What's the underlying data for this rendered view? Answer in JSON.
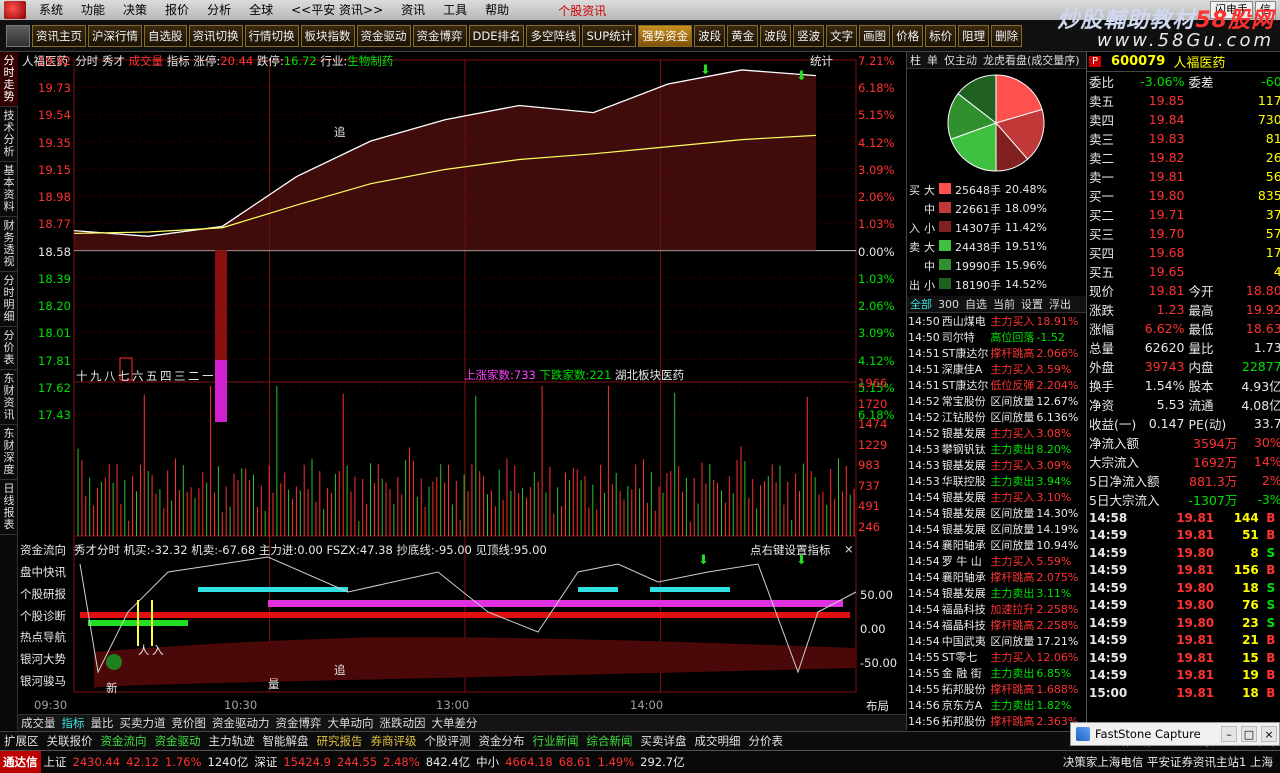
{
  "menu": {
    "items": [
      "系统",
      "功能",
      "决策",
      "报价",
      "分析",
      "全球",
      "<<平安 资讯>>",
      "资讯",
      "工具",
      "帮助"
    ],
    "center_text": "个股资讯",
    "right_buttons": [
      "闪电手",
      "信"
    ]
  },
  "toolbar": {
    "buttons": [
      "资讯主页",
      "沪深行情",
      "自选股",
      "资讯切换",
      "行情切换",
      "板块指数",
      "资金驱动",
      "资金博弈",
      "DDE排名",
      "多空阵线",
      "SUP统计",
      "强势资金",
      "波段",
      "黄金",
      "波段",
      "竖波",
      "文字",
      "画图",
      "价格",
      "标价",
      "阻理",
      "删除"
    ],
    "active_index": 11
  },
  "watermark": {
    "line1_a": "炒股輔助教材",
    "line1_b": "58股网",
    "line2": "www.58Gu.com"
  },
  "left_tabs": [
    "分时走势",
    "技术分析",
    "基本资料",
    "财务透视",
    "分时明细",
    "分价表",
    "东财资讯",
    "东财深度",
    "日线报表"
  ],
  "chart": {
    "header": {
      "name": "人福医药",
      "mode": "分时",
      "tags": [
        "秀才",
        "成交量",
        "指标"
      ],
      "limit_up_label": "涨停:",
      "limit_up": "20.44",
      "limit_down_label": "跌停:",
      "limit_down": "16.72",
      "industry_label": "行业:",
      "industry": "生物制药",
      "stats": "统计"
    },
    "price_ticks": [
      "19.92",
      "19.73",
      "19.54",
      "19.35",
      "19.15",
      "18.98",
      "18.77",
      "18.58",
      "18.39",
      "18.20",
      "18.01",
      "17.81",
      "17.62",
      "17.43"
    ],
    "pct_ticks": [
      "7.21%",
      "6.18%",
      "5.15%",
      "4.12%",
      "3.09%",
      "2.06%",
      "1.03%",
      "0.00%",
      "1.03%",
      "2.06%",
      "3.09%",
      "4.12%",
      "5.15%",
      "6.18%"
    ],
    "vol_ticks": [
      "1966",
      "1720",
      "1474",
      "1229",
      "983",
      "737",
      "491",
      "246"
    ],
    "pos_labels": [
      "十",
      "九",
      "八",
      "七",
      "六",
      "五",
      "四",
      "三",
      "二",
      "一"
    ],
    "up_count_label": "上涨家数:",
    "up_count": "733",
    "down_count_label": "下跌家数:",
    "down_count": "221",
    "sector": "湖北板块医药",
    "chase_label": "追",
    "panel2_title": "资金流向",
    "panel2_line": "秀才分时  机买:-32.32  机卖:-67.68  主力进:0.00  FSZX:47.38  抄底线:-95.00  见顶线:95.00",
    "panel2_right": "点右键设置指标",
    "panel2_ticks": [
      "50.00",
      "0.00",
      "-50.00"
    ],
    "panel2_marks": [
      "新",
      "量",
      "追",
      "入",
      "人"
    ],
    "side_menu": [
      "盘中快讯",
      "个股研报",
      "个股诊断",
      "热点导航",
      "银河大势",
      "银河骏马"
    ],
    "time_labels": [
      "09:30",
      "10:30",
      "13:00",
      "14:00"
    ],
    "layout_btn": "布局"
  },
  "chart_data": {
    "type": "line",
    "title": "人福医药 分时",
    "x": [
      "09:30",
      "10:30",
      "13:00",
      "14:00",
      "15:00"
    ],
    "y_range": [
      17.43,
      19.92
    ],
    "prev_close": 18.58,
    "price": [
      18.72,
      18.68,
      18.75,
      19.1,
      19.35,
      19.5,
      19.6,
      19.55,
      19.75,
      19.85,
      19.81
    ],
    "avg": [
      18.7,
      18.71,
      18.74,
      18.9,
      19.05,
      19.15,
      19.22,
      19.26,
      19.31,
      19.36,
      19.39
    ]
  },
  "flow": {
    "tabs": [
      "柱",
      "单",
      "仅主动",
      "龙虎看盘(成交量序)"
    ],
    "rows": [
      {
        "side": "买",
        "size": "大",
        "val": "25648手",
        "pct": "20.48%",
        "color": "#ff5050"
      },
      {
        "side": "",
        "size": "中",
        "val": "22661手",
        "pct": "18.09%",
        "color": "#c03838"
      },
      {
        "side": "入",
        "size": "小",
        "val": "14307手",
        "pct": "11.42%",
        "color": "#802020"
      },
      {
        "side": "卖",
        "size": "大",
        "val": "24438手",
        "pct": "19.51%",
        "color": "#40c040"
      },
      {
        "side": "",
        "size": "中",
        "val": "19990手",
        "pct": "15.96%",
        "color": "#309030"
      },
      {
        "side": "出",
        "size": "小",
        "val": "18190手",
        "pct": "14.52%",
        "color": "#206020"
      }
    ],
    "pie": [
      20.48,
      18.09,
      11.42,
      19.51,
      15.96,
      14.52
    ]
  },
  "news_tabs": [
    "全部",
    "300",
    "自选",
    "当前",
    "设置",
    "浮出"
  ],
  "news": [
    [
      "14:50",
      "西山煤电",
      "主力买入",
      "18.91%",
      "r"
    ],
    [
      "14:50",
      "司尔特",
      "高位回落",
      "-1.52",
      "g"
    ],
    [
      "14:51",
      "ST康达尔",
      "撑杆跳高",
      "2.066%",
      "r"
    ],
    [
      "14:51",
      "深康佳A",
      "主力买入",
      "3.59%",
      "r"
    ],
    [
      "14:51",
      "ST康达尔",
      "低位反弹",
      "2.204%",
      "r"
    ],
    [
      "14:52",
      "常宝股份",
      "区间放量",
      "12.67%",
      "w"
    ],
    [
      "14:52",
      "江钻股份",
      "区间放量",
      "6.136%",
      "w"
    ],
    [
      "14:52",
      "银基发展",
      "主力买入",
      "3.08%",
      "r"
    ],
    [
      "14:53",
      "攀钢钒钛",
      "主力卖出",
      "8.20%",
      "g"
    ],
    [
      "14:53",
      "银基发展",
      "主力买入",
      "3.09%",
      "r"
    ],
    [
      "14:53",
      "华联控股",
      "主力卖出",
      "3.94%",
      "g"
    ],
    [
      "14:54",
      "银基发展",
      "主力买入",
      "3.10%",
      "r"
    ],
    [
      "14:54",
      "银基发展",
      "区间放量",
      "14.30%",
      "w"
    ],
    [
      "14:54",
      "银基发展",
      "区间放量",
      "14.19%",
      "w"
    ],
    [
      "14:54",
      "襄阳轴承",
      "区间放量",
      "10.94%",
      "w"
    ],
    [
      "14:54",
      "罗 牛 山",
      "主力买入",
      "5.59%",
      "r"
    ],
    [
      "14:54",
      "襄阳轴承",
      "撑杆跳高",
      "2.075%",
      "r"
    ],
    [
      "14:54",
      "银基发展",
      "主力卖出",
      "3.11%",
      "g"
    ],
    [
      "14:54",
      "福晶科技",
      "加速拉升",
      "2.258%",
      "r"
    ],
    [
      "14:54",
      "福晶科技",
      "撑杆跳高",
      "2.258%",
      "r"
    ],
    [
      "14:54",
      "中国武夷",
      "区间放量",
      "17.21%",
      "w"
    ],
    [
      "14:55",
      "ST零七",
      "主力买入",
      "12.06%",
      "r"
    ],
    [
      "14:55",
      "金 融 街",
      "主力卖出",
      "6.85%",
      "g"
    ],
    [
      "14:55",
      "拓邦股份",
      "撑杆跳高",
      "1.688%",
      "r"
    ],
    [
      "14:56",
      "京东方A",
      "主力卖出",
      "1.82%",
      "g"
    ],
    [
      "14:56",
      "拓邦股份",
      "撑杆跳高",
      "2.363%",
      "r"
    ],
    [
      "14:56",
      "南 京 港",
      "加速拉升",
      "4.463%",
      "r"
    ],
    [
      "14:56",
      "福晶科技",
      "区间放量",
      "10.94%",
      "w"
    ],
    [
      "14:56",
      "拓邦股份",
      "单笔冲击",
      "-2",
      "g"
    ]
  ],
  "quote": {
    "code": "600079",
    "name": "人福医药",
    "wei_bi_label": "委比",
    "wei_bi": "-3.06%",
    "wei_cha_label": "委差",
    "wei_cha": "-60",
    "asks": [
      {
        "l": "卖五",
        "p": "19.85",
        "v": "117"
      },
      {
        "l": "卖四",
        "p": "19.84",
        "v": "730"
      },
      {
        "l": "卖三",
        "p": "19.83",
        "v": "81"
      },
      {
        "l": "卖二",
        "p": "19.82",
        "v": "26"
      },
      {
        "l": "卖一",
        "p": "19.81",
        "v": "56"
      }
    ],
    "bids": [
      {
        "l": "买一",
        "p": "19.80",
        "v": "835"
      },
      {
        "l": "买二",
        "p": "19.71",
        "v": "37"
      },
      {
        "l": "买三",
        "p": "19.70",
        "v": "57"
      },
      {
        "l": "买四",
        "p": "19.68",
        "v": "17"
      },
      {
        "l": "买五",
        "p": "19.65",
        "v": "4"
      }
    ],
    "stats": [
      [
        "现价",
        "19.81",
        "今开",
        "18.80"
      ],
      [
        "涨跌",
        "1.23",
        "最高",
        "19.92"
      ],
      [
        "涨幅",
        "6.62%",
        "最低",
        "18.63"
      ],
      [
        "总量",
        "62620",
        "量比",
        "1.73"
      ],
      [
        "外盘",
        "39743",
        "内盘",
        "22877"
      ],
      [
        "换手",
        "1.54%",
        "股本",
        "4.93亿"
      ],
      [
        "净资",
        "5.53",
        "流通",
        "4.08亿"
      ],
      [
        "收益(一)",
        "0.147",
        "PE(动)",
        "33.7"
      ]
    ],
    "flows": [
      [
        "净流入额",
        "3594万",
        "30%"
      ],
      [
        "大宗流入",
        "1692万",
        "14%"
      ],
      [
        "5日净流入额",
        "881.3万",
        "2%"
      ],
      [
        "5日大宗流入",
        "-1307万",
        "-3%"
      ]
    ],
    "deals": [
      [
        "14:58",
        "19.81",
        "144",
        "B"
      ],
      [
        "14:59",
        "19.81",
        "51",
        "B"
      ],
      [
        "14:59",
        "19.80",
        "8",
        "S"
      ],
      [
        "14:59",
        "19.81",
        "156",
        "B"
      ],
      [
        "14:59",
        "19.80",
        "18",
        "S"
      ],
      [
        "14:59",
        "19.80",
        "76",
        "S"
      ],
      [
        "14:59",
        "19.80",
        "23",
        "S"
      ],
      [
        "14:59",
        "19.81",
        "21",
        "B"
      ],
      [
        "14:59",
        "19.81",
        "15",
        "B"
      ],
      [
        "14:59",
        "19.81",
        "19",
        "B"
      ],
      [
        "15:00",
        "19.81",
        "18",
        "B"
      ]
    ]
  },
  "bottom_tabs1": [
    "成交量",
    "指标",
    "量比",
    "买卖力道",
    "竞价图",
    "资金驱动力",
    "资金博弈",
    "大单动向",
    "涨跌动因",
    "大单差分"
  ],
  "bottom_tabs2": [
    "扩展区",
    "关联报价",
    "资金流向",
    "资金驱动",
    "主力轨迹",
    "智能解盘",
    "研究报告",
    "券商评级",
    "个股评测",
    "资金分布",
    "行业新闻",
    "综合新闻",
    "买卖详盘",
    "成交明细",
    "分价表"
  ],
  "bottom_tabs2_right": [
    "资讯工场",
    "主力",
    "关联",
    "分价",
    "筹码"
  ],
  "status": {
    "app": "通达信",
    "sh_label": "上证",
    "sh": "2430.44",
    "sh_chg": "42.12",
    "sh_pct": "1.76%",
    "sh_amt": "1240亿",
    "sz_label": "深证",
    "sz": "15424.9",
    "sz_chg": "244.55",
    "sz_pct": "2.48%",
    "sz_amt": "842.4亿",
    "zx_label": "中小",
    "zx": "4664.18",
    "zx_chg": "68.61",
    "zx_pct": "1.49%",
    "zx_amt": "292.7亿",
    "ticker": "决策家上海电信 平安证券资讯主站1 上海"
  },
  "fastone": {
    "title": "FastStone Capture"
  }
}
